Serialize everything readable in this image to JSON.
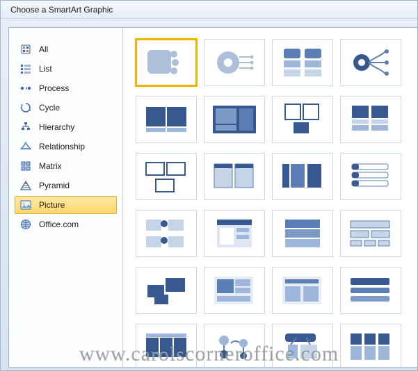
{
  "dialog": {
    "title": "Choose a SmartArt Graphic"
  },
  "sidebar": {
    "items": [
      {
        "key": "all",
        "label": "All",
        "selected": false
      },
      {
        "key": "list",
        "label": "List",
        "selected": false
      },
      {
        "key": "process",
        "label": "Process",
        "selected": false
      },
      {
        "key": "cycle",
        "label": "Cycle",
        "selected": false
      },
      {
        "key": "hierarchy",
        "label": "Hierarchy",
        "selected": false
      },
      {
        "key": "relationship",
        "label": "Relationship",
        "selected": false
      },
      {
        "key": "matrix",
        "label": "Matrix",
        "selected": false
      },
      {
        "key": "pyramid",
        "label": "Pyramid",
        "selected": false
      },
      {
        "key": "picture",
        "label": "Picture",
        "selected": true
      },
      {
        "key": "officecom",
        "label": "Office.com",
        "selected": false
      }
    ]
  },
  "gallery": {
    "selected_index": 0,
    "items": [
      {
        "name": "accented-picture",
        "selected": true
      },
      {
        "name": "circular-picture-callout",
        "selected": false
      },
      {
        "name": "bending-picture-accent-list",
        "selected": false
      },
      {
        "name": "radial-picture-list",
        "selected": false
      },
      {
        "name": "picture-caption-list",
        "selected": false
      },
      {
        "name": "snapshot-picture-list",
        "selected": false
      },
      {
        "name": "picture-grid",
        "selected": false
      },
      {
        "name": "picture-accent-blocks",
        "selected": false
      },
      {
        "name": "bending-picture-blocks",
        "selected": false
      },
      {
        "name": "captioned-pictures",
        "selected": false
      },
      {
        "name": "picture-strips",
        "selected": false
      },
      {
        "name": "titled-picture-accent-list",
        "selected": false
      },
      {
        "name": "bubble-picture-list",
        "selected": false
      },
      {
        "name": "vertical-picture-list",
        "selected": false
      },
      {
        "name": "picture-accent-list",
        "selected": false
      },
      {
        "name": "titled-picture-blocks",
        "selected": false
      },
      {
        "name": "framed-text-picture",
        "selected": false
      },
      {
        "name": "continuous-picture-list",
        "selected": false
      },
      {
        "name": "spiral-picture",
        "selected": false
      },
      {
        "name": "horizontal-picture-list",
        "selected": false
      },
      {
        "name": "hexagon-cluster",
        "selected": false
      },
      {
        "name": "picture-frame",
        "selected": false
      },
      {
        "name": "alternating-picture-circles",
        "selected": false
      },
      {
        "name": "ascending-picture-accent",
        "selected": false
      }
    ]
  },
  "watermark": {
    "text": "www.carolscorneroffice.com"
  },
  "colors": {
    "blue": "#5b7fb5",
    "blue_dark": "#37598f",
    "blue_light": "#aebfd9",
    "selection": "#f3b200"
  }
}
